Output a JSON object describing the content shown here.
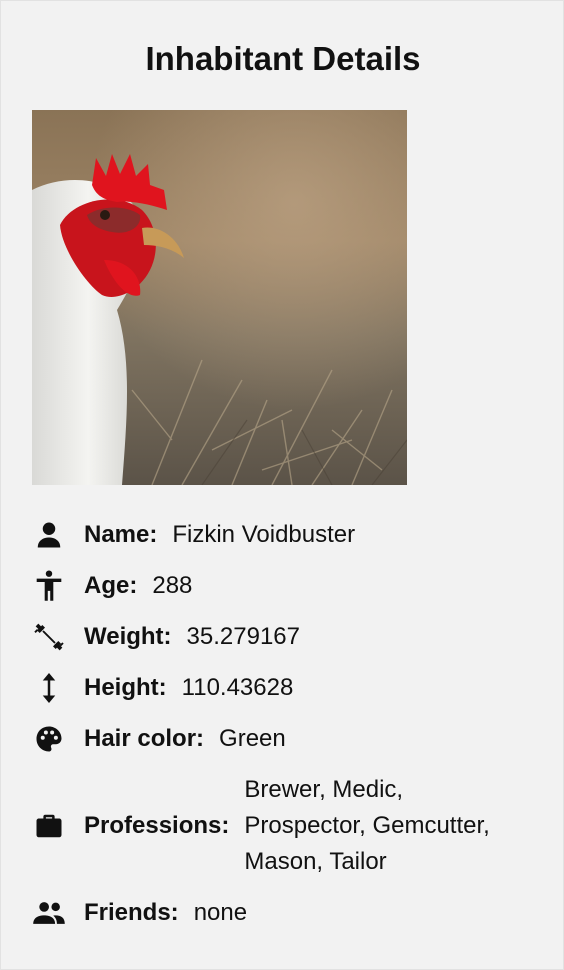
{
  "page": {
    "title": "Inhabitant Details"
  },
  "photo": {
    "subject": "white chicken with red comb"
  },
  "details": {
    "name": {
      "label": "Name:",
      "value": "Fizkin Voidbuster",
      "icon": "person-icon"
    },
    "age": {
      "label": "Age:",
      "value": "288",
      "icon": "accessibility-icon"
    },
    "weight": {
      "label": "Weight:",
      "value": "35.279167",
      "icon": "dumbbell-icon"
    },
    "height": {
      "label": "Height:",
      "value": "110.43628",
      "icon": "vertical-arrows-icon"
    },
    "hair_color": {
      "label": "Hair color:",
      "value": "Green",
      "icon": "palette-icon"
    },
    "professions": {
      "label": "Professions:",
      "lines": [
        "Brewer, Medic,",
        "Prospector, Gemcutter,",
        "Mason, Tailor"
      ],
      "icon": "briefcase-icon"
    },
    "friends": {
      "label": "Friends:",
      "value": "none",
      "icon": "people-icon"
    }
  },
  "colors": {
    "background": "#f2f2f2",
    "text": "#111111"
  }
}
